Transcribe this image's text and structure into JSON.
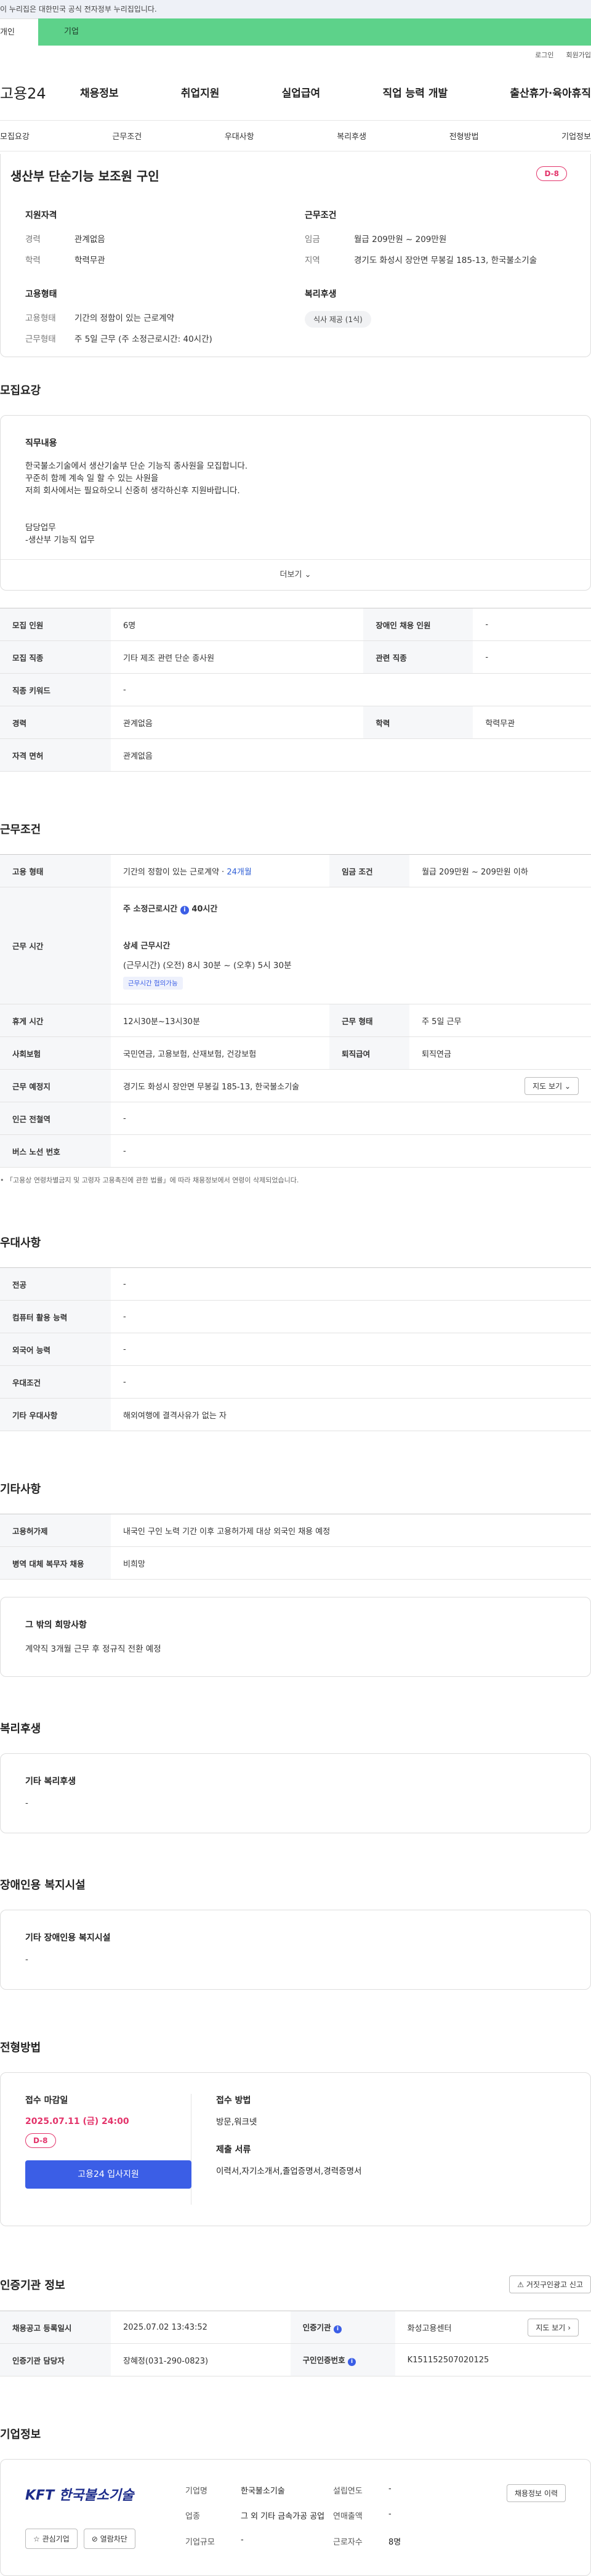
{
  "gov_banner": "이 누리집은 대한민국 공식 전자정부 누리집입니다.",
  "site_tabs": {
    "personal": "개인",
    "company": "기업"
  },
  "util": {
    "login": "로그인",
    "signup": "회원가입"
  },
  "logo": "고용24",
  "gnb": [
    "채용정보",
    "취업지원",
    "실업급여",
    "직업 능력 개발",
    "출산휴가·육아휴직"
  ],
  "anchor_tabs": [
    "모집요강",
    "근무조건",
    "우대사항",
    "복리후생",
    "전형방법",
    "기업정보"
  ],
  "summary": {
    "title": "생산부 단순기능 보조원 구인",
    "dday": "D-8",
    "qual_heading": "지원자격",
    "qual": [
      {
        "k": "경력",
        "v": "관계없음"
      },
      {
        "k": "학력",
        "v": "학력무관"
      }
    ],
    "work_heading": "근무조건",
    "work": [
      {
        "k": "임금",
        "v": "월급 209만원 ~ 209만원"
      },
      {
        "k": "지역",
        "v": "경기도 화성시 장안면 무봉길 185-13, 한국불소기술"
      }
    ],
    "emp_heading": "고용형태",
    "emp": [
      {
        "k": "고용형태",
        "v": "기간의 정함이 있는 근로계약"
      },
      {
        "k": "근무형태",
        "v": "주 5일 근무 (주 소정근로시간: 40시간)"
      }
    ],
    "welfare_heading": "복리후생",
    "welfare_chip": "식사 제공 (1식)"
  },
  "recruit": {
    "section": "모집요강",
    "duty_heading": "직무내용",
    "duty_lines": [
      "한국불소기술에서 생산기술부 단순 기능직 종사원을 모집합니다.",
      "꾸준히 함께 계속 일 할 수 있는 사원을",
      "저희 회사에서는 필요하오니 신중히 생각하신후 지원바랍니다.",
      "",
      "",
      "담당업무",
      "-생산부 기능직 업무"
    ],
    "more": "더보기",
    "table": [
      [
        {
          "k": "모집 인원",
          "v": "6명"
        },
        {
          "k": "장애인 채용 인원",
          "v": "-"
        }
      ],
      [
        {
          "k": "모집 직종",
          "v": "기타 제조 관련 단순 종사원"
        },
        {
          "k": "관련 직종",
          "v": "-"
        }
      ],
      [
        {
          "k": "직종 키워드",
          "v": "-"
        }
      ],
      [
        {
          "k": "경력",
          "v": "관계없음"
        },
        {
          "k": "학력",
          "v": "학력무관"
        }
      ],
      [
        {
          "k": "자격 면허",
          "v": "관계없음"
        }
      ]
    ]
  },
  "work_cond": {
    "section": "근무조건",
    "emp_type_k": "고용 형태",
    "emp_type_v": "기간의 정함이 있는 근로계약 · ",
    "emp_type_months": "24개월",
    "wage_k": "임금 조건",
    "wage_v": "월급 209만원 ~ 209만원 이하",
    "hours_k": "근무 시간",
    "hours_weekly_label": "주 소정근로시간",
    "hours_weekly_value": "40시간",
    "hours_detail_label": "상세 근무시간",
    "hours_detail_value": "(근무시간) (오전) 8시 30분 ~ (오후) 5시 30분",
    "hours_tag": "근무시간 협의가능",
    "rest_k": "휴게 시간",
    "rest_v": "12시30분~13시30분",
    "form_k": "근무 형태",
    "form_v": "주 5일 근무",
    "ins_k": "사회보험",
    "ins_v": "국민연금, 고용보험, 산재보험, 건강보험",
    "sev_k": "퇴직급여",
    "sev_v": "퇴직연금",
    "loc_k": "근무 예정지",
    "loc_v": "경기도 화성시 장안면 무봉길 185-13, 한국불소기술",
    "map_btn": "지도 보기",
    "station_k": "인근 전철역",
    "station_v": "-",
    "bus_k": "버스 노선 번호",
    "bus_v": "-",
    "note": "「고용상 연령차별금지 및 고령자 고용촉진에 관한 법률」에 따라 채용정보에서 연령이 삭제되었습니다."
  },
  "pref": {
    "section": "우대사항",
    "rows": [
      {
        "k": "전공",
        "v": "-"
      },
      {
        "k": "컴퓨터 활용 능력",
        "v": "-"
      },
      {
        "k": "외국어 능력",
        "v": "-"
      },
      {
        "k": "우대조건",
        "v": "-"
      },
      {
        "k": "기타 우대사항",
        "v": "해외여행에 결격사유가 없는 자"
      }
    ]
  },
  "other": {
    "section": "기타사항",
    "rows": [
      {
        "k": "고용허가제",
        "v": "내국인 구인 노력 기간 이후 고용허가제 대상 외국인 채용 예정"
      },
      {
        "k": "병역 대체 복무자 채용",
        "v": "비희망"
      }
    ],
    "wish_heading": "그 밖의 희망사항",
    "wish_text": "계약직 3개월 근무 후  정규직 전환 예정"
  },
  "welfare": {
    "section": "복리후생",
    "heading": "기타 복리후생",
    "text": "-"
  },
  "disabled": {
    "section": "장애인용 복지시설",
    "heading": "기타 장애인용 복지시설",
    "text": "-"
  },
  "process": {
    "section": "전형방법",
    "deadline_heading": "접수 마감일",
    "deadline": "2025.07.11 (금) 24:00",
    "dday": "D-8",
    "apply_btn": "고용24 입사지원",
    "method_heading": "접수 방법",
    "method": "방문,워크넷",
    "docs_heading": "제출 서류",
    "docs": "이력서,자기소개서,졸업증명서,경력증명서"
  },
  "cert": {
    "section": "인증기관 정보",
    "report_btn": "거짓구인광고 신고",
    "reg_k": "채용공고 등록일시",
    "reg_v": "2025.07.02 13:43:52",
    "org_k": "인증기관",
    "org_v": "화성고용센터",
    "map_btn": "지도 보기",
    "mgr_k": "인증기관 담당자",
    "mgr_v": "장혜정(031-290-0823)",
    "num_k": "구인인증번호",
    "num_v": "K151152507020125"
  },
  "company": {
    "section": "기업정보",
    "logo_text": "KFT 한국불소기술",
    "fav_btn": "관심기업",
    "block_btn": "열람차단",
    "name_k": "기업명",
    "name_v": "한국불소기술",
    "year_k": "설립연도",
    "year_v": "-",
    "industry_k": "업종",
    "industry_v": "그 외 기타 금속가공 공업",
    "sales_k": "연매출액",
    "sales_v": "-",
    "emp_k": "근로자수",
    "emp_v": "8명",
    "size_k": "기업규모",
    "size_v": "-",
    "history_btn": "채용정보 이력"
  }
}
